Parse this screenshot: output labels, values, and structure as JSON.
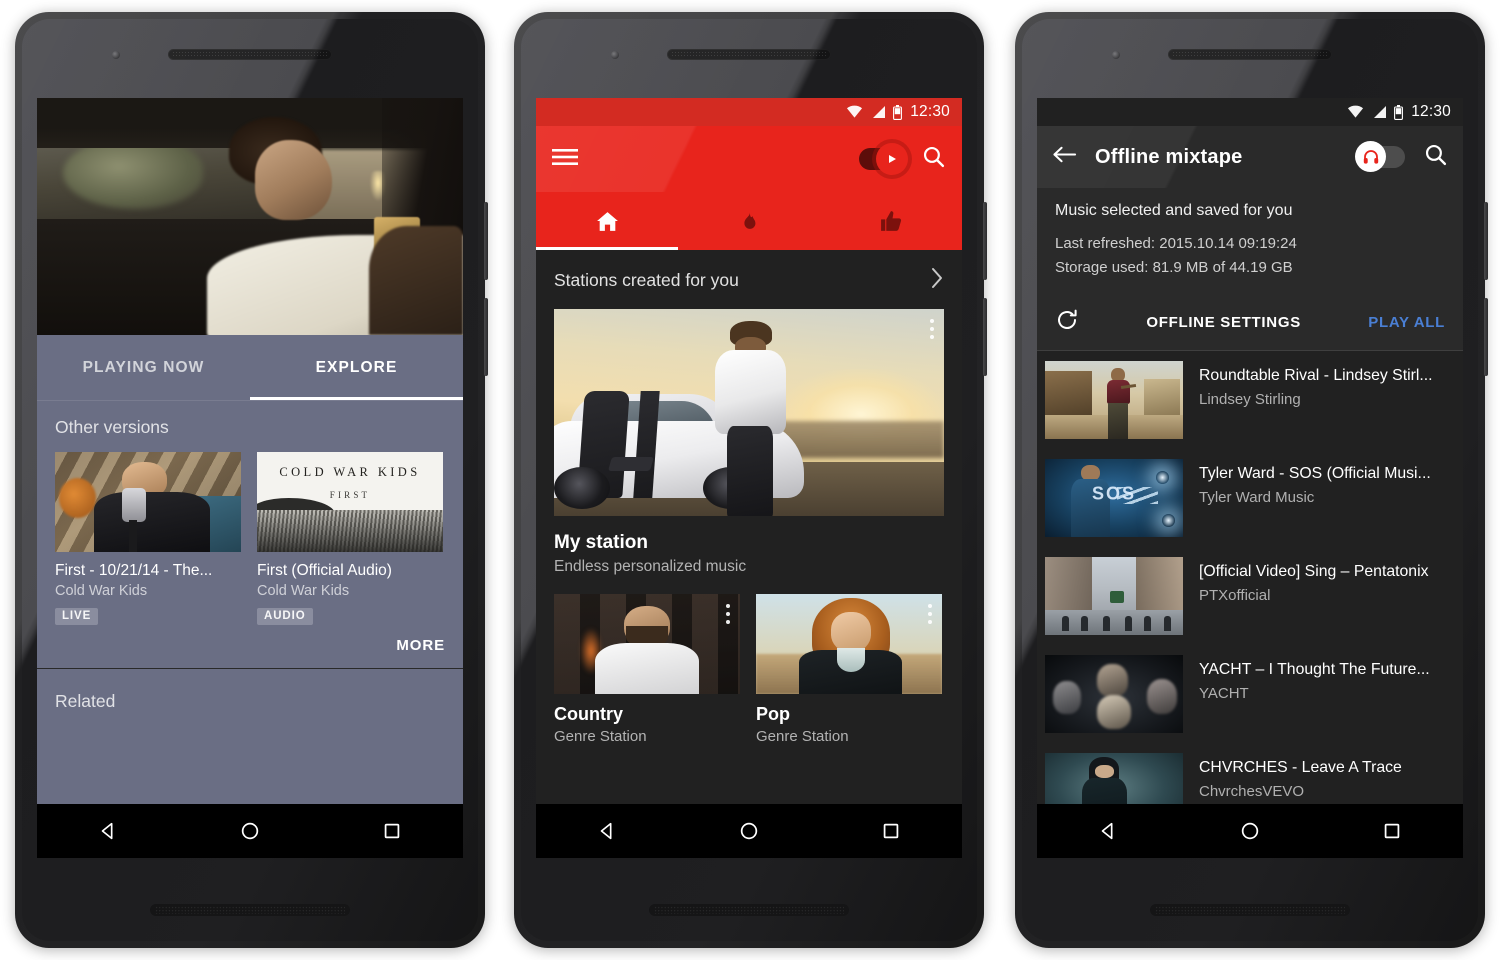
{
  "phone1": {
    "screen_name": "YouTube Music - Explore",
    "tabs": [
      {
        "label": "PLAYING NOW",
        "active": false
      },
      {
        "label": "EXPLORE",
        "active": true
      }
    ],
    "section_title": "Other versions",
    "cards": [
      {
        "title": "First - 10/21/14 - The...",
        "artist": "Cold War Kids",
        "badge": "LIVE",
        "thumb_desc": "man-singing-with-microphone"
      },
      {
        "title": "First (Official Audio)",
        "artist": "Cold War Kids",
        "badge": "AUDIO",
        "thumb_desc": "cold-war-kids-first-album-cover",
        "cover_title": "COLD WAR KIDS",
        "cover_subtitle": "FIRST"
      }
    ],
    "more_label": "MORE",
    "related_label": "Related",
    "video_desc": "man-driving-car-at-night"
  },
  "phone2": {
    "screen_name": "YouTube Music - Home",
    "statusbar": {
      "time": "12:30"
    },
    "appbar": {
      "menu_icon": "hamburger-menu-icon",
      "toggle_icon": "play-toggle-icon",
      "search_icon": "search-icon"
    },
    "tabs": [
      {
        "icon": "home-icon",
        "active": true
      },
      {
        "icon": "trending-flame-icon",
        "active": false
      },
      {
        "icon": "thumbs-up-icon",
        "active": false
      }
    ],
    "section": {
      "title": "Stations created for you",
      "chevron": "chevron-right-icon"
    },
    "hero": {
      "title": "My station",
      "subtitle": "Endless personalized music",
      "overflow_icon": "kebab-menu-icon",
      "image_desc": "man-leaning-on-white-sports-car-at-sunset"
    },
    "cards": [
      {
        "title": "Country",
        "subtitle": "Genre Station",
        "overflow_icon": "kebab-menu-icon",
        "thumb_desc": "bearded-man-in-white-shirt"
      },
      {
        "title": "Pop",
        "subtitle": "Genre Station",
        "overflow_icon": "kebab-menu-icon",
        "thumb_desc": "curly-haired-woman-in-landscape"
      }
    ]
  },
  "phone3": {
    "screen_name": "Offline mixtape",
    "statusbar": {
      "time": "12:30"
    },
    "appbar": {
      "back_icon": "back-arrow-icon",
      "title": "Offline mixtape",
      "toggle_icon": "headphones-icon",
      "search_icon": "search-icon"
    },
    "info": {
      "main": "Music selected and saved for you",
      "last_refreshed": "Last refreshed: 2015.10.14 09:19:24",
      "storage_used": "Storage used: 81.9 MB of 44.19 GB"
    },
    "actions": {
      "refresh_icon": "refresh-icon",
      "settings_label": "OFFLINE SETTINGS",
      "play_all_label": "PLAY ALL",
      "play_all_color": "#4a7fd4"
    },
    "items": [
      {
        "title": "Roundtable Rival - Lindsey Stirl...",
        "channel": "Lindsey Stirling",
        "thumb_desc": "violinist-in-desert-town"
      },
      {
        "title": "Tyler Ward - SOS (Official Musi...",
        "channel": "Tyler Ward Music",
        "thumb_desc": "singer-on-blue-stage-sos",
        "thumb_text": "SOS"
      },
      {
        "title": "[Official Video] Sing – Pentatonix",
        "channel": "PTXofficial",
        "thumb_desc": "people-crossing-city-street"
      },
      {
        "title": "YACHT – I Thought The Future...",
        "channel": "YACHT",
        "thumb_desc": "dark-faces-in-shadow"
      },
      {
        "title": "CHVRCHES - Leave A Trace",
        "channel": "ChvrchesVEVO",
        "thumb_desc": "woman-in-teal-mist"
      }
    ]
  },
  "navbar": {
    "back_label": "back-button",
    "home_label": "home-button",
    "recents_label": "recents-button"
  },
  "colors": {
    "youtube_red": "#e8241c",
    "panel_blue_gray": "#6a6e84",
    "dark_surface": "#212121",
    "appbar_dark": "#2a2a2a",
    "link_blue": "#4a7fd4"
  }
}
